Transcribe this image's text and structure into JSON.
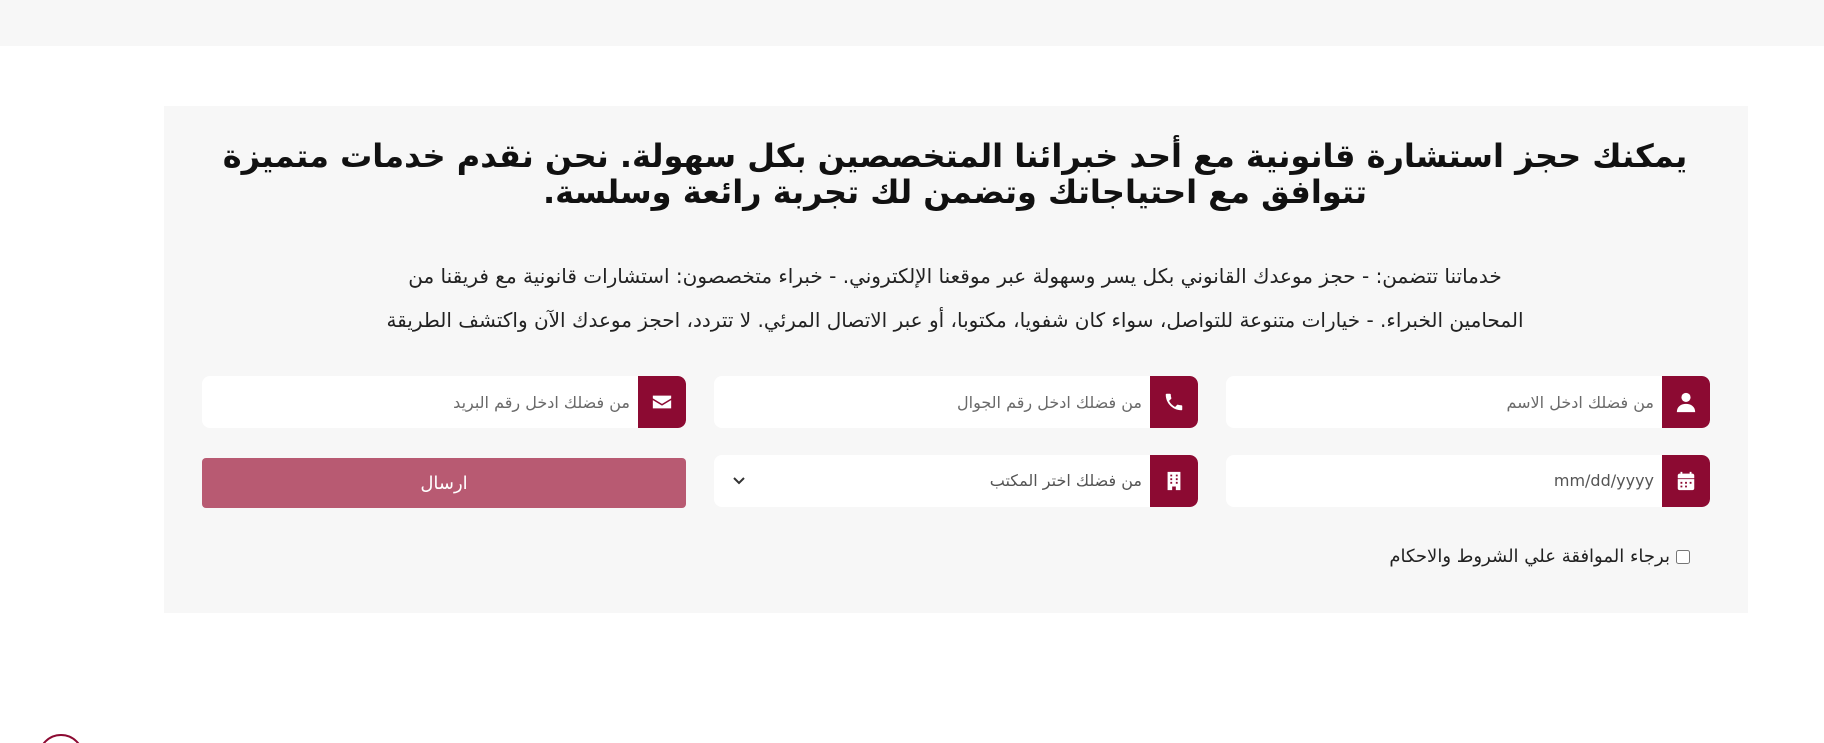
{
  "headline": "يمكنك حجز استشارة قانونية مع أحد خبرائنا المتخصصين بكل سهولة. نحن نقدم خدمات متميزة تتوافق مع احتياجاتك وتضمن لك تجربة رائعة وسلسة.",
  "description": "خدماتنا تتضمن: - حجز موعدك القانوني بكل يسر وسهولة عبر موقعنا الإلكتروني. - خبراء متخصصون: استشارات قانونية مع فريقنا من المحامين الخبراء. - خيارات متنوعة للتواصل، سواء كان شفويا، مكتوبا، أو عبر الاتصال المرئي. لا تتردد، احجز موعدك الآن واكتشف الطريقة",
  "form": {
    "name": {
      "placeholder": "من فضلك ادخل الاسم",
      "icon": "user-icon"
    },
    "phone": {
      "placeholder": "من فضلك ادخل رقم الجوال",
      "icon": "phone-icon"
    },
    "email": {
      "placeholder": "من فضلك ادخل رقم البريد",
      "icon": "envelope-icon"
    },
    "date": {
      "value": "mm/dd/yyyy",
      "icon": "calendar-icon"
    },
    "office": {
      "value": "من فضلك اختر المكتب",
      "icon": "building-icon"
    },
    "submit_label": "ارسال",
    "terms_label": "برجاء الموافقة علي الشروط والاحكام"
  },
  "colors": {
    "accent": "#8c0a32",
    "button": "#b85a72",
    "card_bg": "#f7f7f7"
  }
}
